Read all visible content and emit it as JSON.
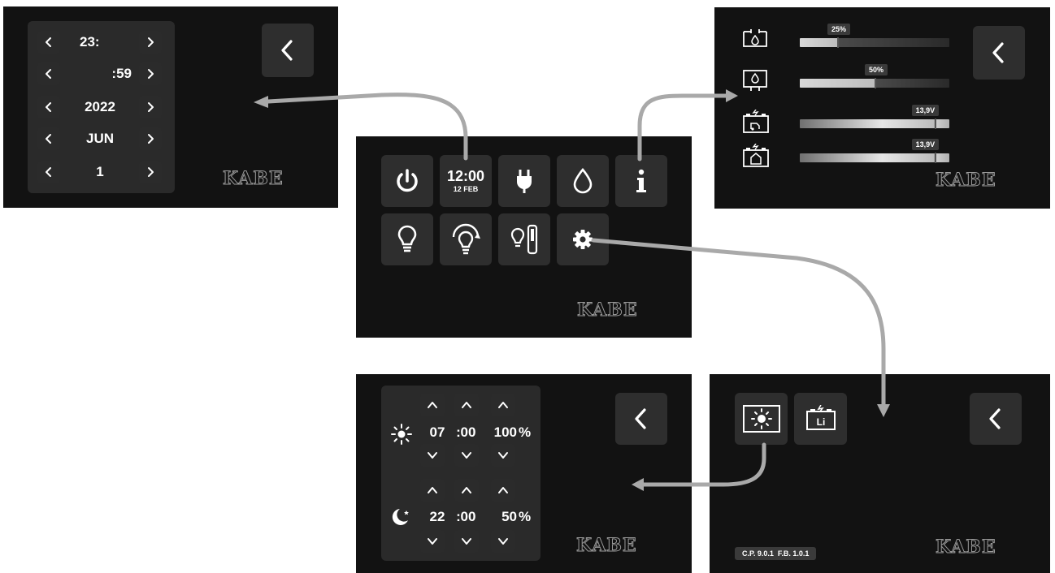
{
  "home": {
    "time": "12:00",
    "date": "12 FEB",
    "icons": [
      "power-icon",
      "clock-icon",
      "plug-icon",
      "water-drop-icon",
      "info-icon",
      "light-bulb-icon",
      "dimmer-bulb-icon",
      "light-switch-icon",
      "gear-icon"
    ],
    "logo": "KABE"
  },
  "datetime": {
    "rows": [
      "23:",
      ":59",
      "2022",
      "JUN",
      "1"
    ],
    "logo": "KABE"
  },
  "info": {
    "tanks": [
      {
        "icon": "fresh-water-tank-icon",
        "tag": "25%",
        "level": 0.25
      },
      {
        "icon": "grey-water-tank-icon",
        "tag": "50%",
        "level": 0.5
      },
      {
        "icon": "vehicle-battery-icon",
        "tag": "13,9V",
        "level": 0.9
      },
      {
        "icon": "living-battery-icon",
        "tag": "13,9V",
        "level": 0.9
      }
    ],
    "logo": "KABE"
  },
  "settings": {
    "icons": [
      "brightness-icon",
      "lithium-battery-icon"
    ],
    "battery_label": "Li",
    "version": "C.P. 9.0.1  F.B. 1.0.1",
    "logo": "KABE"
  },
  "brightness": {
    "day": {
      "hour": "07",
      "sep": ":",
      "minute": "00",
      "level": "100",
      "unit": "%"
    },
    "night": {
      "hour": "22",
      "sep": ":",
      "minute": "00",
      "level": "50",
      "unit": "%"
    },
    "logo": "KABE"
  }
}
